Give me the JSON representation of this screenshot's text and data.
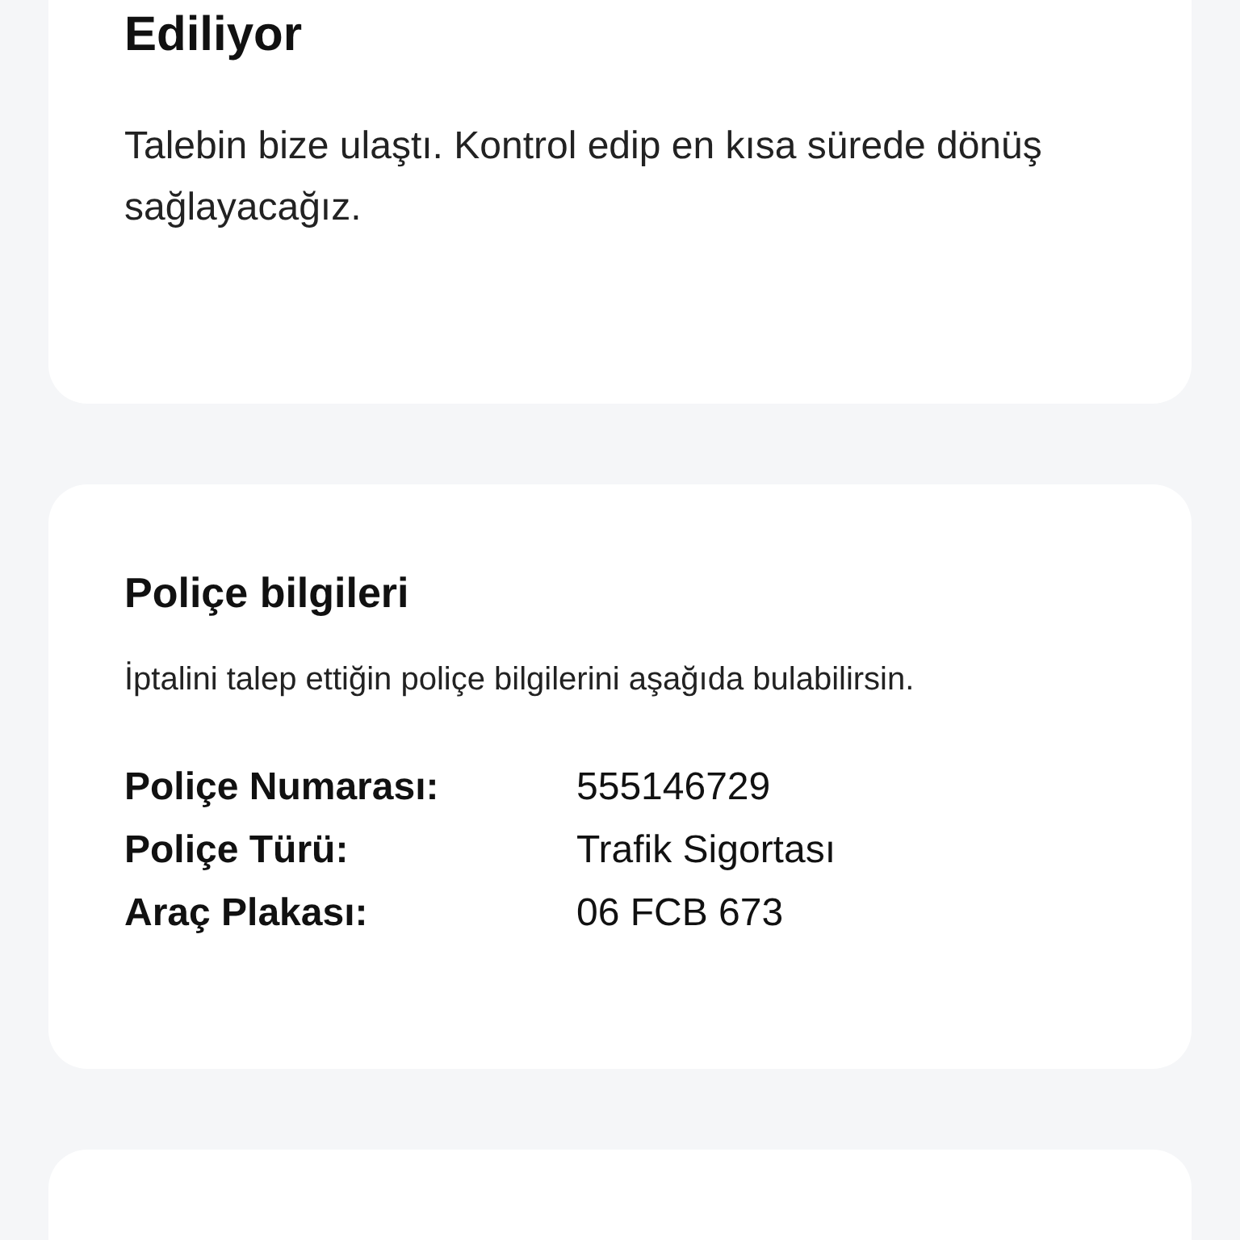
{
  "status_card": {
    "title": "Ediliyor",
    "message": "Talebin bize ulaştı. Kontrol edip en kısa sürede dönüş sağlayacağız."
  },
  "policy_card": {
    "title": "Poliçe bilgileri",
    "description": "İptalini talep ettiğin poliçe bilgilerini aşağıda bulabilirsin.",
    "rows": [
      {
        "label": "Poliçe Numarası:",
        "value": "555146729"
      },
      {
        "label": "Poliçe Türü:",
        "value": "Trafik Sigortası"
      },
      {
        "label": "Araç Plakası:",
        "value": "06 FCB 673"
      }
    ]
  }
}
